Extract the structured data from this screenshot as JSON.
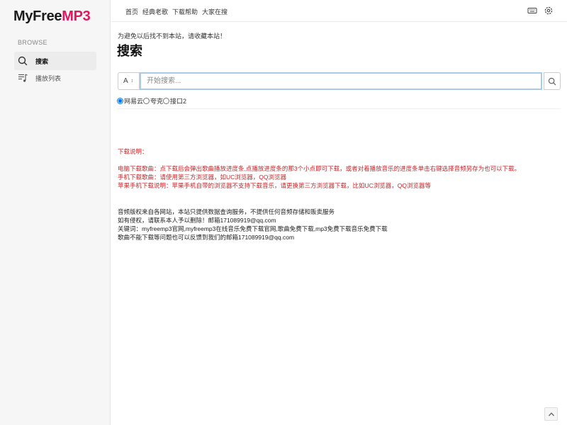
{
  "brand": {
    "name_part1": "MyFree",
    "name_part2": "MP3",
    "accent": "#e0195f"
  },
  "sidebar": {
    "section_label": "BROWSE",
    "items": [
      {
        "label": "搜索",
        "icon": "search-icon",
        "active": true
      },
      {
        "label": "播放列表",
        "icon": "playlist-icon",
        "active": false
      }
    ]
  },
  "topnav": {
    "links": [
      "首页",
      "经典老歌",
      "下载帮助",
      "大家在搜"
    ],
    "icons": [
      "keyboard-icon",
      "gear-icon"
    ]
  },
  "main": {
    "notice": "为避免以后找不到本站，请收藏本站！",
    "title": "搜索",
    "search": {
      "type_value": "A",
      "placeholder": "开始搜索..."
    },
    "sources": [
      {
        "label": "网易云",
        "checked": true
      },
      {
        "label": "夸克",
        "checked": false
      },
      {
        "label": "接口2",
        "checked": false
      }
    ],
    "help_heading": "下载说明：",
    "help_lines": [
      "电脑下载歌曲：点下载后会弹出歌曲播放进度条,点播放进度条的那3个小点即可下载，或者对着播放音乐的进度条单击右键选择音频另存为也可以下载。",
      "手机下载歌曲：请使用第三方浏览器，如UC浏览器，QQ浏览器",
      "苹果手机下载说明：苹果手机自带的浏览器不支持下载音乐，请更换第三方浏览器下载，比如UC浏览器，QQ浏览器等"
    ],
    "info_lines": [
      "音频版权来自各网站，本站只提供数据查询服务，不提供任何音频存储和贩卖服务",
      "如有侵权，请联系本人予以删除！邮箱171089919@qq.com",
      "关键词：myfreemp3官网,myfreemp3在线音乐免费下载官网,歌曲免费下载,mp3免费下载音乐免费下载",
      "歌曲不能下载等问题也可以反馈到我们的邮箱171089919@qq.com"
    ]
  },
  "colors": {
    "help_text": "#c8272b",
    "input_focus": "#a9cbe8"
  }
}
